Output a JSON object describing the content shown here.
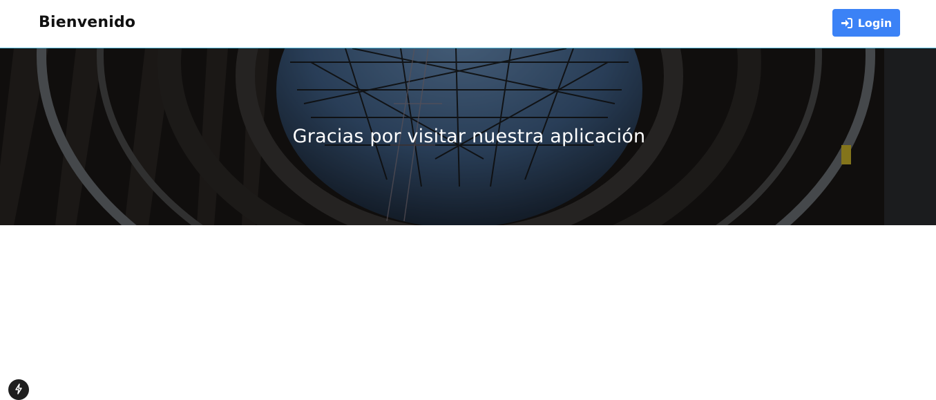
{
  "header": {
    "brand": "Bienvenido",
    "login_label": "Login",
    "login_icon": "sign-in-icon",
    "login_color": "#3b82f6"
  },
  "hero": {
    "message": "Gracias por visitar nuestra aplicación",
    "image": "architecture-dome-background"
  },
  "floating_badge": {
    "icon": "lightning-bolt-icon"
  }
}
